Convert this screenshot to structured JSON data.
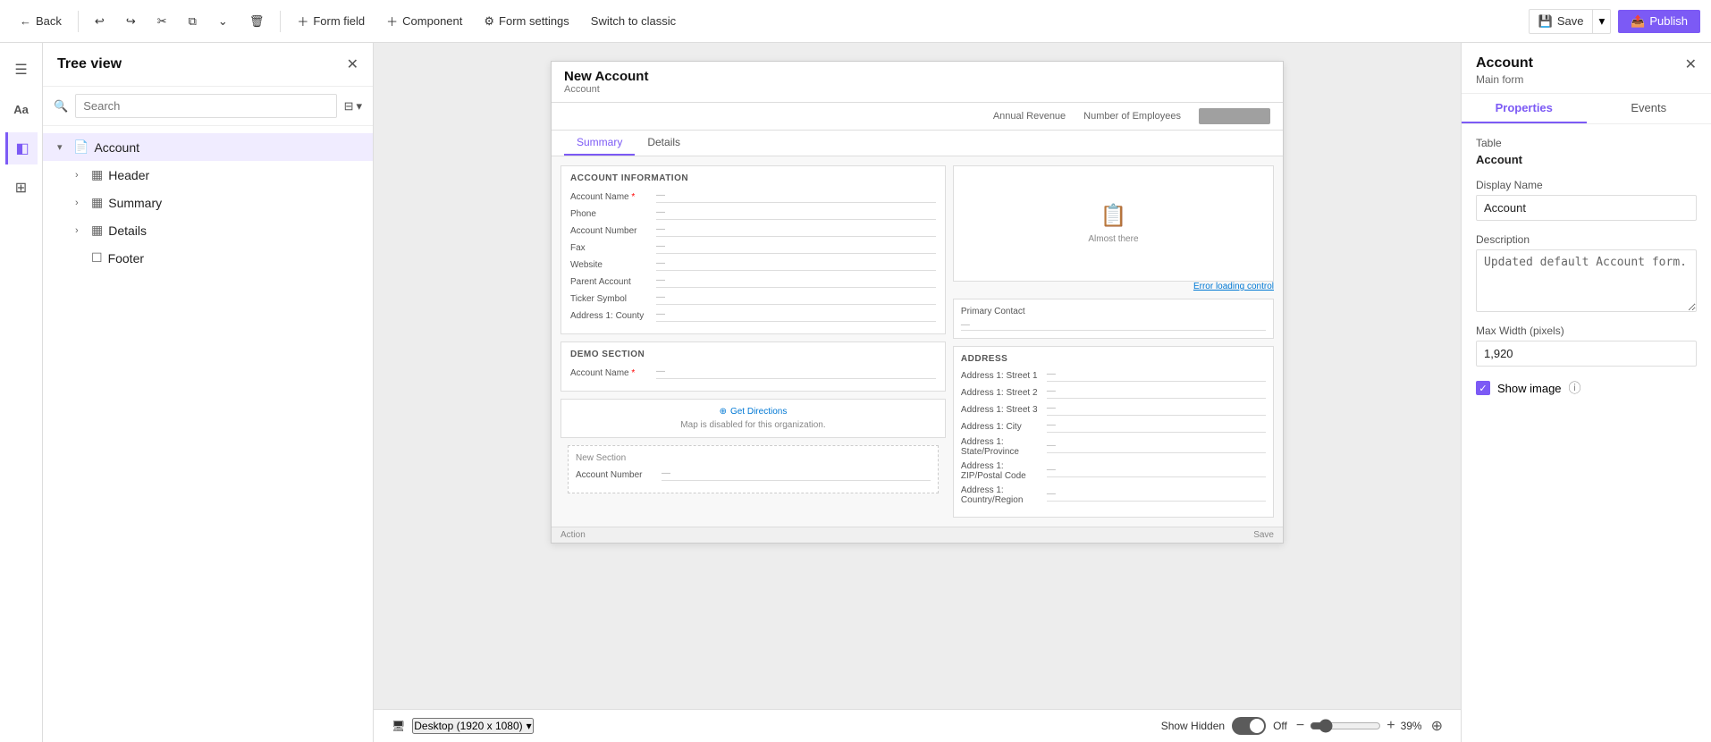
{
  "toolbar": {
    "back_label": "Back",
    "form_field_label": "Form field",
    "component_label": "Component",
    "form_settings_label": "Form settings",
    "switch_classic_label": "Switch to classic",
    "save_label": "Save",
    "publish_label": "Publish",
    "undo_icon": "↩",
    "redo_icon": "↪",
    "cut_icon": "✂",
    "copy_icon": "⧉",
    "delete_icon": "🗑",
    "history_icon": "⌄"
  },
  "sidebar": {
    "title": "Tree view",
    "search_placeholder": "Search",
    "items": [
      {
        "label": "Account",
        "level": 0,
        "expandable": true,
        "icon": "📄",
        "selected": true
      },
      {
        "label": "Header",
        "level": 1,
        "expandable": true,
        "icon": "▦"
      },
      {
        "label": "Summary",
        "level": 1,
        "expandable": true,
        "icon": "▦"
      },
      {
        "label": "Details",
        "level": 1,
        "expandable": true,
        "icon": "▦"
      },
      {
        "label": "Footer",
        "level": 1,
        "expandable": false,
        "icon": "☐"
      }
    ]
  },
  "left_icons": [
    {
      "name": "menu-icon",
      "glyph": "☰"
    },
    {
      "name": "text-icon",
      "glyph": "A"
    },
    {
      "name": "layers-icon",
      "glyph": "◧"
    },
    {
      "name": "apps-icon",
      "glyph": "⊞"
    }
  ],
  "canvas": {
    "form": {
      "title": "New Account",
      "subtitle": "Account",
      "header_fields": [
        "Annual Revenue",
        "Number of Employees"
      ],
      "tabs": [
        "Summary",
        "Details"
      ],
      "active_tab": "Summary",
      "sections": {
        "account_info_title": "ACCOUNT INFORMATION",
        "fields": [
          {
            "label": "Account Name",
            "required": true,
            "value": "—"
          },
          {
            "label": "Phone",
            "required": false,
            "value": "—"
          },
          {
            "label": "Account Number",
            "required": false,
            "value": "—"
          },
          {
            "label": "Fax",
            "required": false,
            "value": "—"
          },
          {
            "label": "Website",
            "required": false,
            "value": "—"
          },
          {
            "label": "Parent Account",
            "required": false,
            "value": "—"
          },
          {
            "label": "Ticker Symbol",
            "required": false,
            "value": "—"
          },
          {
            "label": "Address 1: County",
            "required": false,
            "value": "—"
          }
        ],
        "demo_section_title": "Demo Section",
        "demo_fields": [
          {
            "label": "Account Name",
            "required": true,
            "value": "—"
          }
        ],
        "address_title": "ADDRESS",
        "address_fields": [
          {
            "label": "Address 1: Street 1",
            "value": "—"
          },
          {
            "label": "Address 1: Street 2",
            "value": "—"
          },
          {
            "label": "Address 1: Street 3",
            "value": "—"
          },
          {
            "label": "Address 1: City",
            "value": "—"
          },
          {
            "label": "Address 1: State/Province",
            "value": "—"
          },
          {
            "label": "Address 1: ZIP/Postal Code",
            "value": "—"
          },
          {
            "label": "Address 1: Country/Region",
            "value": "—"
          }
        ],
        "primary_contact_label": "Primary Contact",
        "primary_contact_value": "—",
        "error_link": "Error loading control",
        "timeline_text": "Almost there",
        "get_directions_label": "Get Directions",
        "map_disabled_text": "Map is disabled for this organization.",
        "new_section_title": "New Section",
        "new_section_fields": [
          {
            "label": "Account Number",
            "value": "—"
          }
        ]
      }
    },
    "bottom": {
      "desktop_label": "Desktop (1920 x 1080)",
      "show_hidden_label": "Show Hidden",
      "toggle_state": "Off",
      "zoom_label": "39%"
    }
  },
  "right_panel": {
    "title": "Account",
    "subtitle": "Main form",
    "tabs": [
      "Properties",
      "Events"
    ],
    "active_tab": "Properties",
    "fields": {
      "table_label": "Table",
      "table_value": "Account",
      "display_name_label": "Display Name",
      "display_name_value": "Account",
      "description_label": "Description",
      "description_value": "Updated default Account form.",
      "max_width_label": "Max Width (pixels)",
      "max_width_value": "1,920",
      "show_image_label": "Show image",
      "show_image_checked": true
    }
  }
}
